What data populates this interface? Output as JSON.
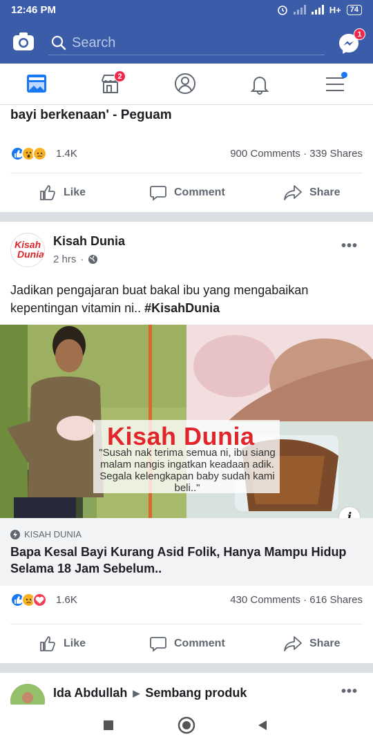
{
  "status_bar": {
    "time": "12:46 PM",
    "network": "H+",
    "battery": "74"
  },
  "search": {
    "placeholder": "Search",
    "messenger_badge": "1"
  },
  "tabs": [
    {
      "name": "news-feed",
      "badge": ""
    },
    {
      "name": "marketplace",
      "badge": "2"
    },
    {
      "name": "profile",
      "badge": ""
    },
    {
      "name": "notifications",
      "badge": ""
    },
    {
      "name": "menu",
      "badge": "dot"
    }
  ],
  "post1": {
    "headline_tail": "bayi berkenaan' - Peguam",
    "reaction_count": "1.4K",
    "comments": "900 Comments",
    "shares": "339 Shares",
    "reactions": [
      "like",
      "wow",
      "sad"
    ]
  },
  "actions": {
    "like": "Like",
    "comment": "Comment",
    "share": "Share"
  },
  "post2": {
    "author": "Kisah Dunia",
    "time": "2 hrs",
    "avatar_text_1": "Kisah",
    "avatar_text_2": "Dunia",
    "text": "Jadikan pengajaran buat bakal ibu yang mengabaikan kepentingan vitamin ni.. ",
    "hashtag": "#KisahDunia",
    "image_logo": "Kisah Dunia",
    "image_quote": "\"Susah nak terima semua ni, ibu siang malam nangis ingatkan keadaan adik. Segala kelengkapan baby sudah kami beli..\"",
    "link_source": "KISAH DUNIA",
    "link_title": "Bapa Kesal Bayi Kurang Asid Folik, Hanya Mampu Hidup Selama 18 Jam Sebelum..",
    "reaction_count": "1.6K",
    "comments": "430 Comments",
    "shares": "616 Shares",
    "reactions": [
      "like",
      "sad",
      "love"
    ]
  },
  "post3": {
    "author": "Ida Abdullah",
    "group": "Sembang produk"
  },
  "colors": {
    "brand": "#3b5ca8",
    "badge": "#f02849",
    "like": "#1877f2",
    "love": "#f33e58",
    "haha": "#f7b125"
  }
}
